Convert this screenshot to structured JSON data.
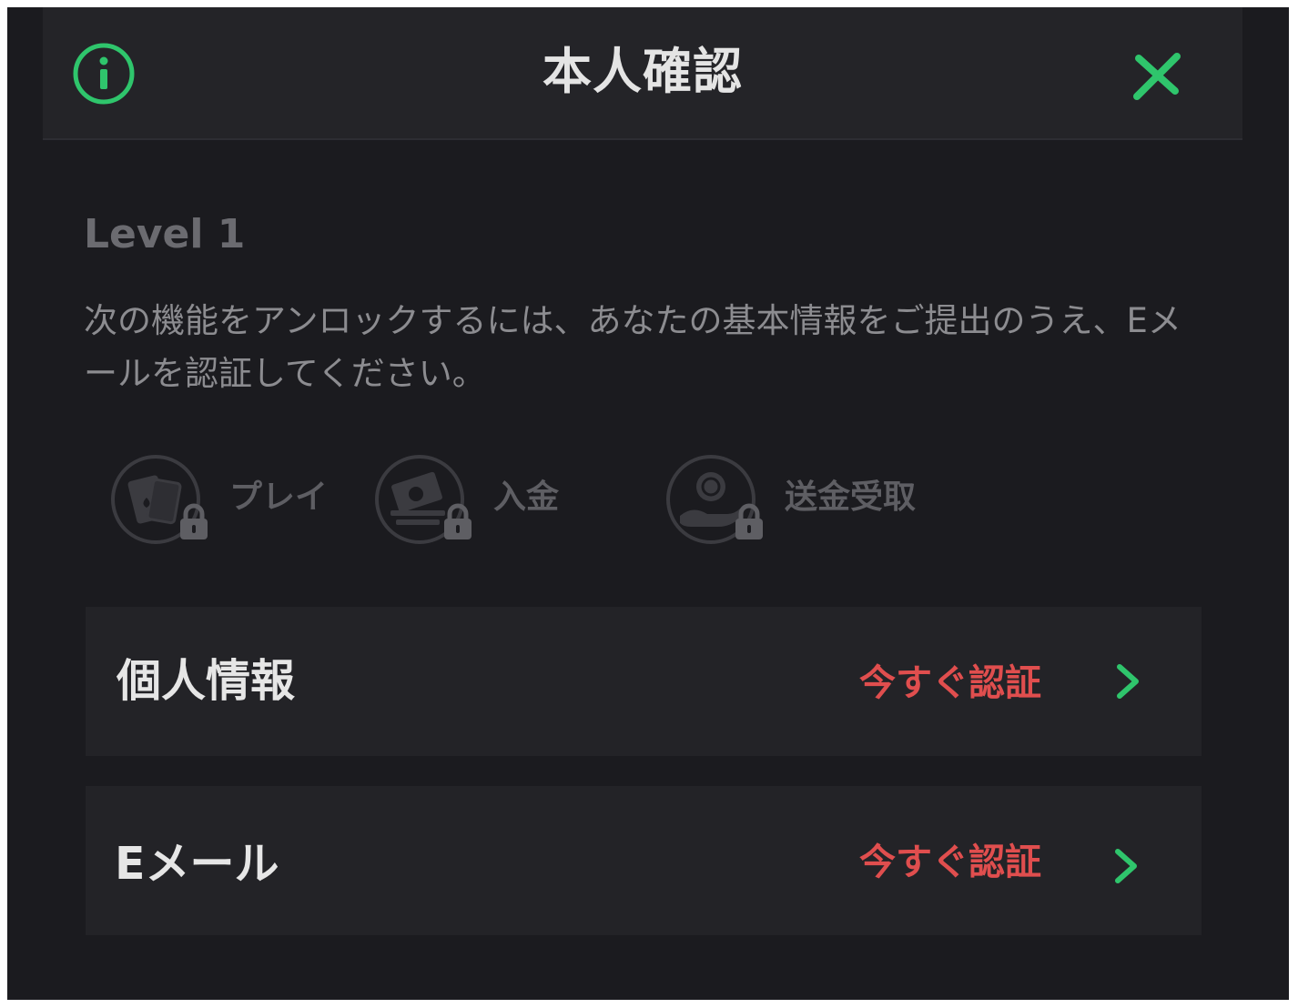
{
  "header": {
    "title": "本人確認",
    "info_icon": "info-circle-icon",
    "close_icon": "close-x-icon"
  },
  "level": {
    "label": "Level 1",
    "description": "次の機能をアンロックするには、あなたの基本情報をご提出のうえ、Eメールを認証してください。"
  },
  "features": [
    {
      "label": "プレイ",
      "icon": "playing-cards-icon",
      "locked": true
    },
    {
      "label": "入金",
      "icon": "cash-deposit-icon",
      "locked": true
    },
    {
      "label": "送金受取",
      "icon": "coin-receive-icon",
      "locked": true
    }
  ],
  "verification_items": [
    {
      "label": "個人情報",
      "action": "今すぐ認証"
    },
    {
      "label": "Eメール",
      "action": "今すぐ認証"
    }
  ],
  "colors": {
    "accent_green": "#2fc56c",
    "action_red": "#e04e4e",
    "background": "#1b1b1f",
    "panel": "#232327"
  }
}
